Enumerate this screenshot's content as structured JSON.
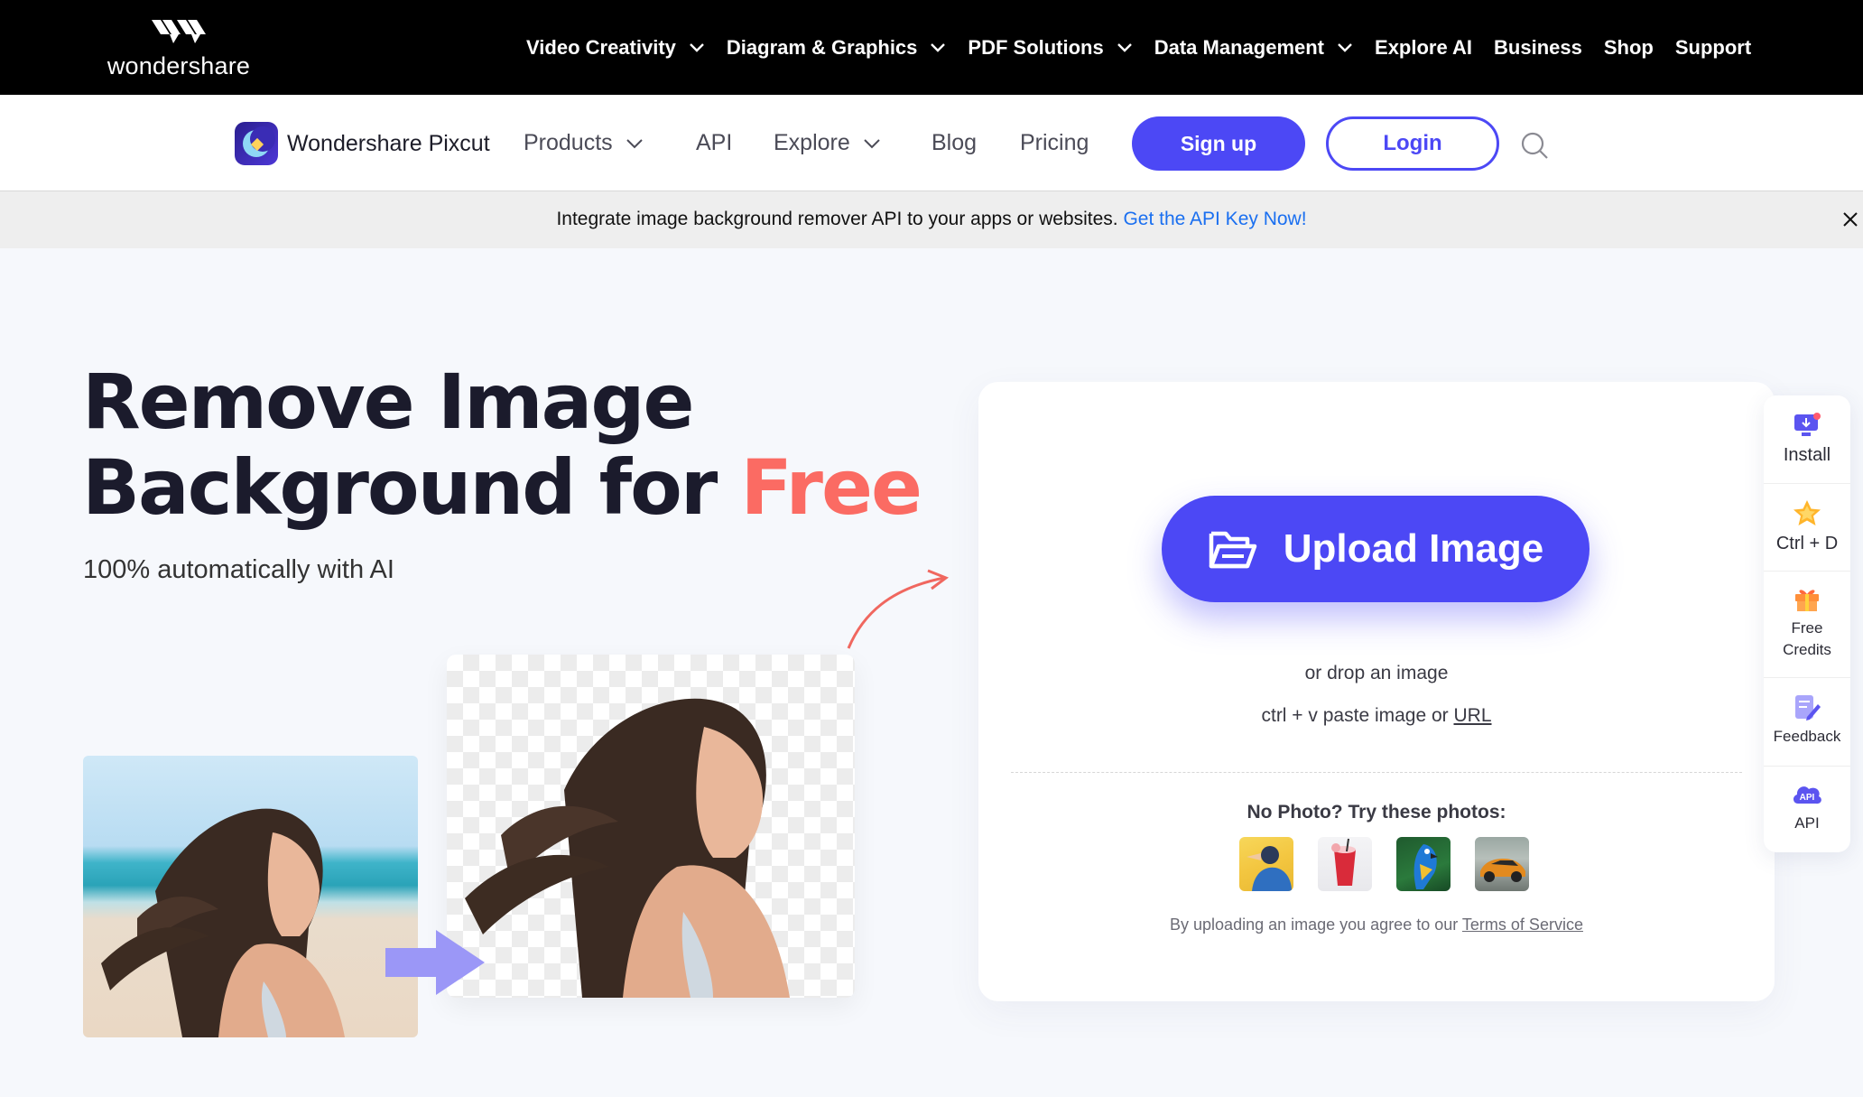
{
  "topbar": {
    "logo_text": "wondershare",
    "nav": [
      {
        "label": "Video Creativity",
        "dropdown": true
      },
      {
        "label": "Diagram & Graphics",
        "dropdown": true
      },
      {
        "label": "PDF Solutions",
        "dropdown": true
      },
      {
        "label": "Data Management",
        "dropdown": true
      },
      {
        "label": "Explore AI",
        "dropdown": false
      },
      {
        "label": "Business",
        "dropdown": false
      },
      {
        "label": "Shop",
        "dropdown": false
      },
      {
        "label": "Support",
        "dropdown": false
      }
    ]
  },
  "product_nav": {
    "brand": "Wondershare Pixcut",
    "items": [
      {
        "label": "Products",
        "dropdown": true
      },
      {
        "label": "API",
        "dropdown": false
      },
      {
        "label": "Explore",
        "dropdown": true
      },
      {
        "label": "Blog",
        "dropdown": false
      },
      {
        "label": "Pricing",
        "dropdown": false
      }
    ],
    "signup_label": "Sign up",
    "login_label": "Login"
  },
  "announcement": {
    "text": "Integrate image background remover API to your apps or websites.",
    "link": "Get the API Key Now!"
  },
  "hero": {
    "title_line1": "Remove Image",
    "title_line2_prefix": "Background for",
    "title_highlight": "Free",
    "subtitle": "100% automatically with AI"
  },
  "upload": {
    "button_label": "Upload Image",
    "drop_text": "or drop an image",
    "paste_prefix": "ctrl + v paste image or",
    "url_label": "URL",
    "try_title": "No Photo? Try these photos:",
    "sample_photos": [
      "sample-person",
      "sample-drink",
      "sample-parrot",
      "sample-car"
    ],
    "terms_prefix": "By uploading an image you agree to our",
    "terms_link": "Terms of Service"
  },
  "sidebar": {
    "items": [
      {
        "label": "Install",
        "icon": "install-icon"
      },
      {
        "label": "Ctrl + D",
        "icon": "star-icon"
      },
      {
        "label_line1": "Free",
        "label_line2": "Credits",
        "icon": "gift-icon"
      },
      {
        "label": "Feedback",
        "icon": "feedback-icon"
      },
      {
        "label": "API",
        "icon": "api-icon"
      }
    ]
  },
  "colors": {
    "brand_blue": "#4c48f5",
    "highlight_coral": "#fb6b63",
    "link_blue": "#1a6ff0",
    "topbar_bg": "#000000"
  }
}
